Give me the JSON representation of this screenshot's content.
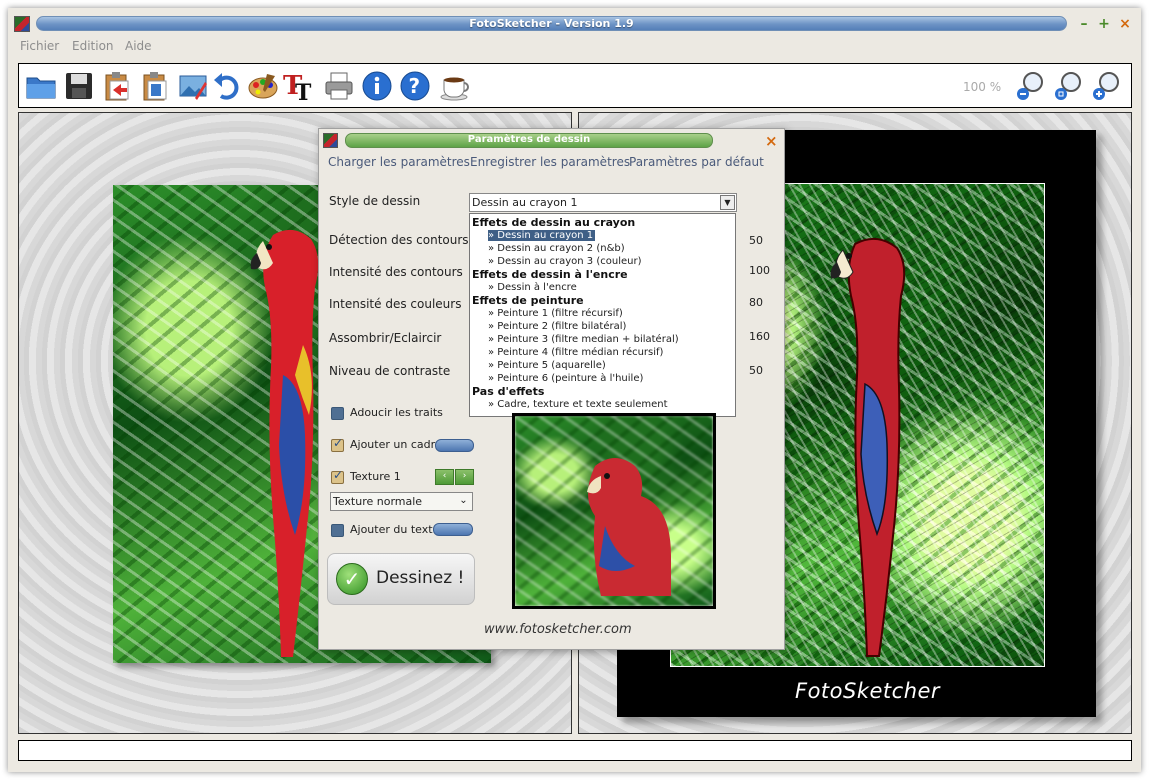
{
  "window": {
    "title": "FotoSketcher - Version 1.9"
  },
  "menu": [
    "Fichier",
    "Edition",
    "Aide"
  ],
  "toolbar": {
    "zoom_level": "100 %",
    "icons": [
      "open-folder-icon",
      "save-icon",
      "paste-icon",
      "copy-icon",
      "image-icon",
      "undo-icon",
      "palette-icon",
      "text-icon",
      "print-icon",
      "info-icon",
      "help-icon",
      "coffee-icon"
    ],
    "zoom_icons": [
      "zoom-out-icon",
      "zoom-fit-icon",
      "zoom-in-icon"
    ]
  },
  "dialog": {
    "title": "Paramètres de dessin",
    "links": {
      "load": "Charger les paramètres",
      "save": "Enregistrer les paramètres",
      "defaults": "Paramètres par défaut"
    },
    "style_label": "Style de dessin",
    "style_value": "Dessin au crayon 1",
    "params": [
      {
        "label": "Détection des contours",
        "value": "50"
      },
      {
        "label": "Intensité des contours",
        "value": "100"
      },
      {
        "label": "Intensité des couleurs",
        "value": "80"
      },
      {
        "label": "Assombrir/Eclaircir",
        "value": "160"
      },
      {
        "label": "Niveau de contraste",
        "value": "50"
      }
    ],
    "checks": {
      "soften": "Adoucir les traits",
      "frame": "Ajouter un cadre",
      "texture": "Texture 1",
      "text": "Ajouter du texte"
    },
    "texture_select": "Texture normale",
    "draw_button": "Dessinez !",
    "website": "www.fotosketcher.com",
    "dropdown": {
      "groups": [
        {
          "header": "Effets de dessin au crayon",
          "items": [
            "» Dessin au crayon 1",
            "» Dessin au crayon 2 (n&b)",
            "» Dessin au crayon 3 (couleur)"
          ]
        },
        {
          "header": "Effets de dessin à l'encre",
          "items": [
            "» Dessin à l'encre"
          ]
        },
        {
          "header": "Effets de peinture",
          "items": [
            "» Peinture 1 (filtre récursif)",
            "» Peinture 2 (filtre bilatéral)",
            "» Peinture 3 (filtre median + bilatéral)",
            "» Peinture 4 (filtre médian récursif)",
            "» Peinture 5 (aquarelle)",
            "» Peinture 6 (peinture à l'huile)"
          ]
        },
        {
          "header": "Pas d'effets",
          "items": [
            "» Cadre, texture et texte seulement"
          ]
        }
      ]
    }
  },
  "result_caption": "FotoSketcher",
  "colors": {
    "title_blue": "#6d93c5",
    "dialog_green": "#5ea347",
    "selection": "#3f5f86"
  }
}
